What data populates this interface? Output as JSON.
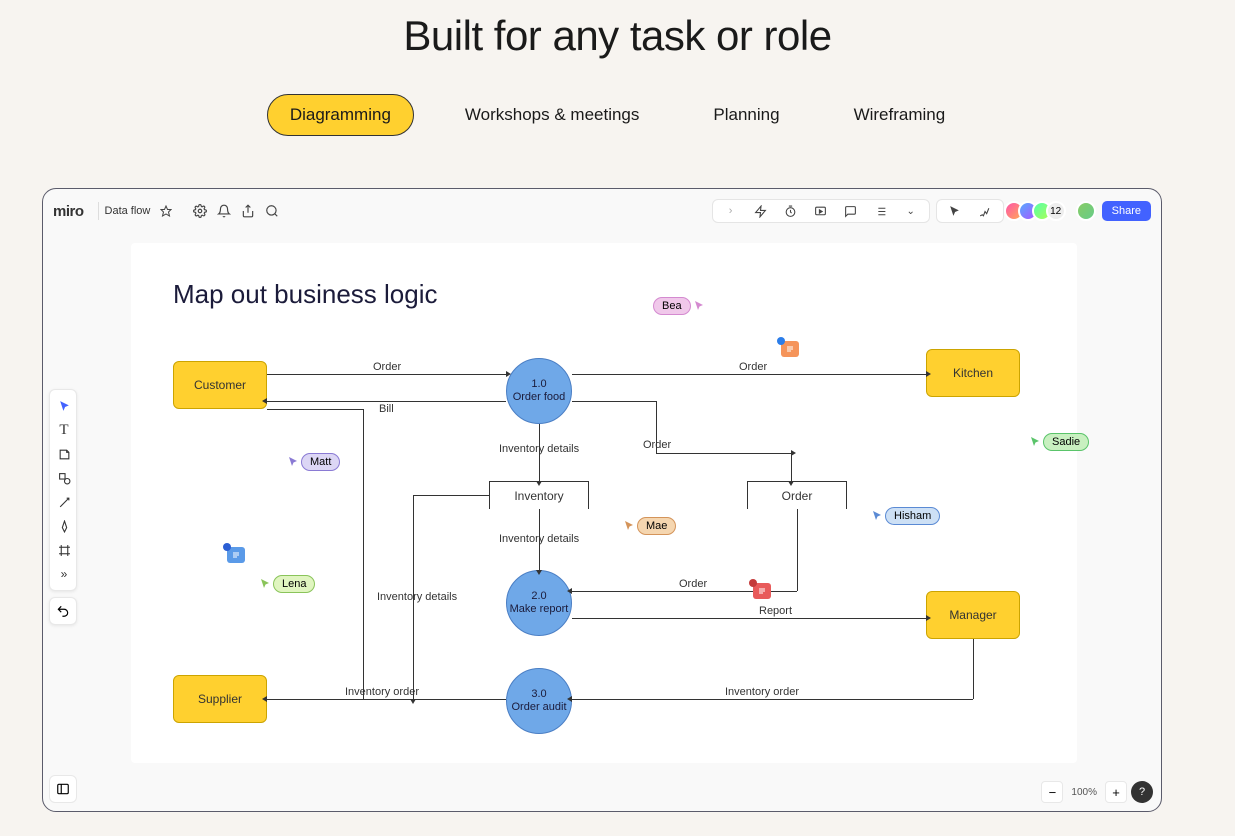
{
  "hero": {
    "title": "Built for any task or role"
  },
  "tabs": [
    {
      "label": "Diagramming",
      "active": true
    },
    {
      "label": "Workshops & meetings",
      "active": false
    },
    {
      "label": "Planning",
      "active": false
    },
    {
      "label": "Wireframing",
      "active": false
    }
  ],
  "app": {
    "logo": "miro",
    "board_name": "Data flow",
    "share_label": "Share",
    "avatar_count": "12",
    "zoom_level": "100%"
  },
  "canvas": {
    "title": "Map out business logic",
    "nodes": {
      "customer": "Customer",
      "kitchen": "Kitchen",
      "supplier": "Supplier",
      "manager": "Manager",
      "inventory": "Inventory",
      "order": "Order",
      "p1_num": "1.0",
      "p1_label": "Order food",
      "p2_num": "2.0",
      "p2_label": "Make report",
      "p3_num": "3.0",
      "p3_label": "Order audit"
    },
    "edges": {
      "order": "Order",
      "bill": "Bill",
      "inv_details": "Inventory details",
      "report": "Report",
      "inv_order": "Inventory order"
    },
    "users": {
      "bea": "Bea",
      "matt": "Matt",
      "mae": "Mae",
      "lena": "Lena",
      "hisham": "Hisham",
      "sadie": "Sadie"
    }
  },
  "colors": {
    "yellow": "#ffd02f",
    "blue_node": "#6fa8e8",
    "bea": "#e9a8e0",
    "matt": "#c9c4f5",
    "mae": "#f5c48a",
    "lena": "#d4f0a8",
    "hisham": "#b8d0f5",
    "sadie": "#b8e8b0",
    "comment_orange": "#f58a4a",
    "comment_red": "#e85a5a",
    "comment_blue": "#5a9ae8"
  }
}
